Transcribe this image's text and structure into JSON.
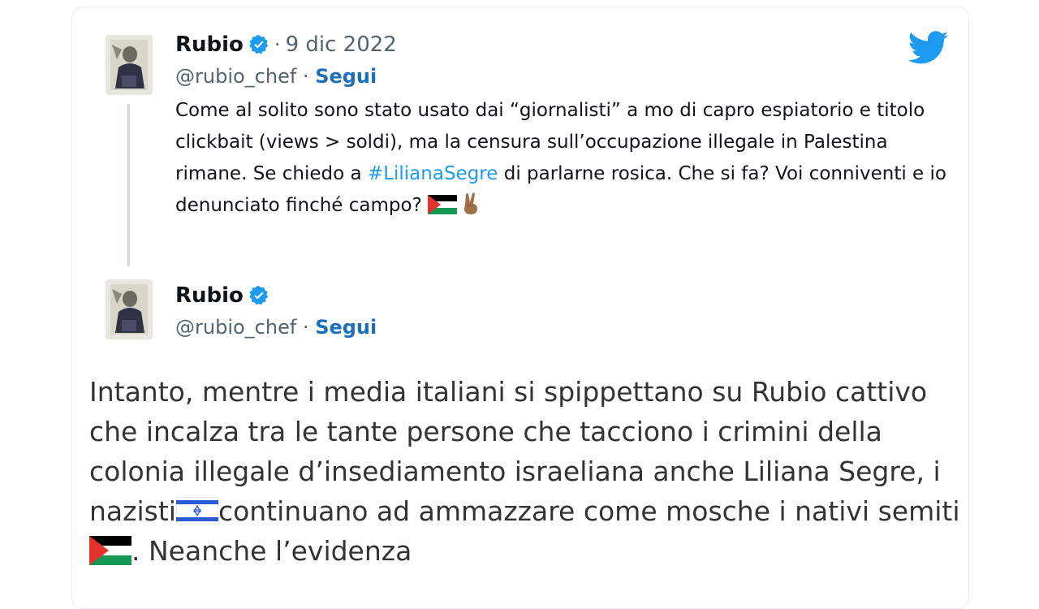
{
  "quoted": {
    "name": "Rubio",
    "separator": "·",
    "date": "9 dic 2022",
    "handle": "@rubio_chef",
    "handle_sep": " · ",
    "follow": "Segui",
    "text_before": "Come al solito sono stato usato dai “giornalisti” a mo di capro espiatorio e titolo clickbait (views > soldi), ma la censura sull’occupazione illegale in Palestina rimane. Se chiedo a ",
    "hashtag": "#LilianaSegre",
    "text_after": " di parlarne rosica. Che si fa? Voi conniventi e io denunciato finché campo? "
  },
  "reply": {
    "name": "Rubio",
    "handle": "@rubio_chef",
    "handle_sep": " · ",
    "follow": "Segui",
    "text_part1": "Intanto, mentre i media italiani si spippettano su Rubio cattivo che incalza tra le tante persone che tacciono i crimini della colonia illegale d’insediamento israeliana anche Liliana Segre, i nazisti",
    "text_part2": "continuano ad ammazzare come mosche i nativi semiti",
    "text_part3": ". Neanche l’evidenza"
  },
  "icons": {
    "verified": "verified-badge-icon",
    "brand": "twitter-bird-icon",
    "flag_ps": "palestine-flag-emoji",
    "flag_il": "israel-flag-emoji",
    "peace": "victory-hand-emoji"
  },
  "colors": {
    "link": "#1d9bf0",
    "follow": "#1d6fb8",
    "muted": "#536471",
    "verified": "#1d9bf0",
    "bird": "#1d9bf0"
  }
}
